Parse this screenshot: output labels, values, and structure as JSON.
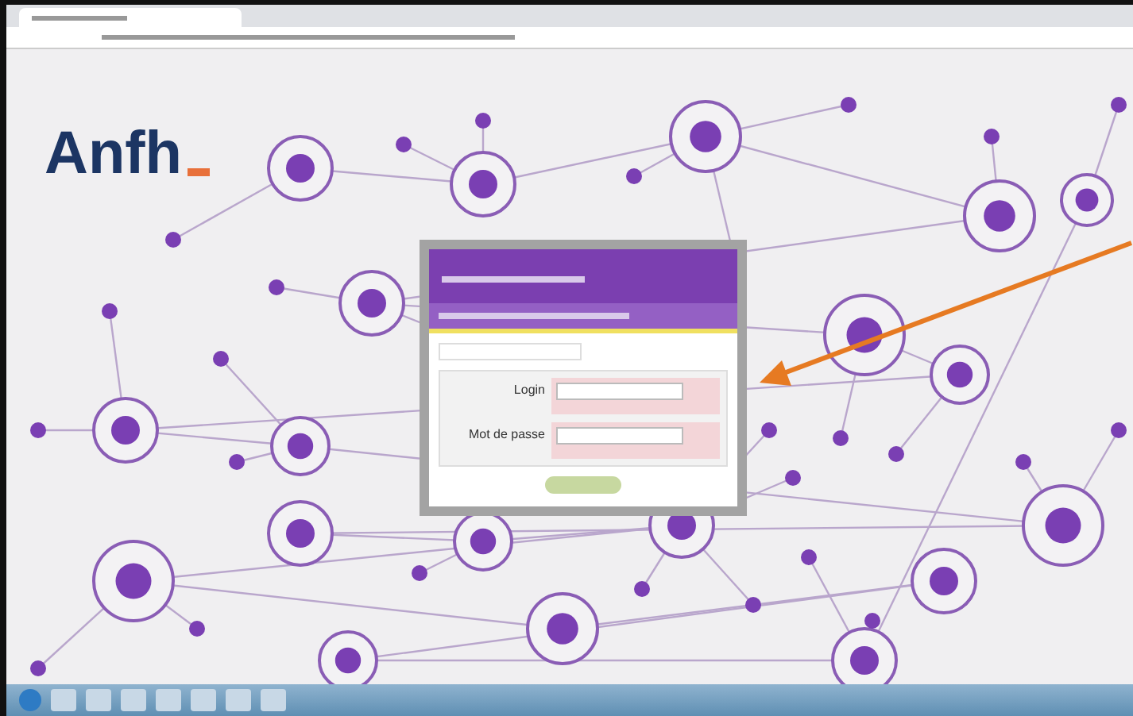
{
  "logo": {
    "text": "Anfh"
  },
  "dialog": {
    "fields": [
      {
        "label": "Login"
      },
      {
        "label": "Mot de passe"
      }
    ]
  }
}
